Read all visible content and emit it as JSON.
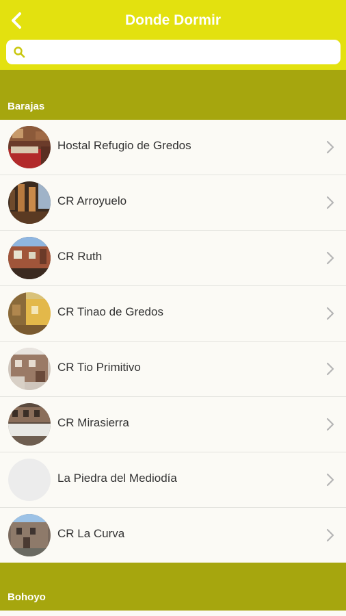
{
  "header": {
    "title": "Donde Dormir",
    "back_icon": "chevron-left-icon"
  },
  "search": {
    "placeholder": "",
    "value": "",
    "icon": "search-icon"
  },
  "sections": [
    {
      "name": "Barajas",
      "items": [
        {
          "label": "Hostal Refugio de Gredos",
          "thumb": "room-photo"
        },
        {
          "label": "CR Arroyuelo",
          "thumb": "wood-interior-photo"
        },
        {
          "label": "CR Ruth",
          "thumb": "house-photo"
        },
        {
          "label": "CR Tinao de Gredos",
          "thumb": "yellow-house-photo"
        },
        {
          "label": "CR Tio Primitivo",
          "thumb": "stone-house-photo"
        },
        {
          "label": "CR Mirasierra",
          "thumb": "balcony-house-photo"
        },
        {
          "label": "La Piedra del Mediodía",
          "thumb": "empty"
        },
        {
          "label": "CR La Curva",
          "thumb": "stone-building-photo"
        }
      ]
    },
    {
      "name": "Bohoyo",
      "items": []
    }
  ],
  "colors": {
    "header": "#e3e10f",
    "section_header": "#a6a60e",
    "list_background": "#fbfaf5",
    "text": "#333333",
    "chevron": "#b5b5b5"
  }
}
